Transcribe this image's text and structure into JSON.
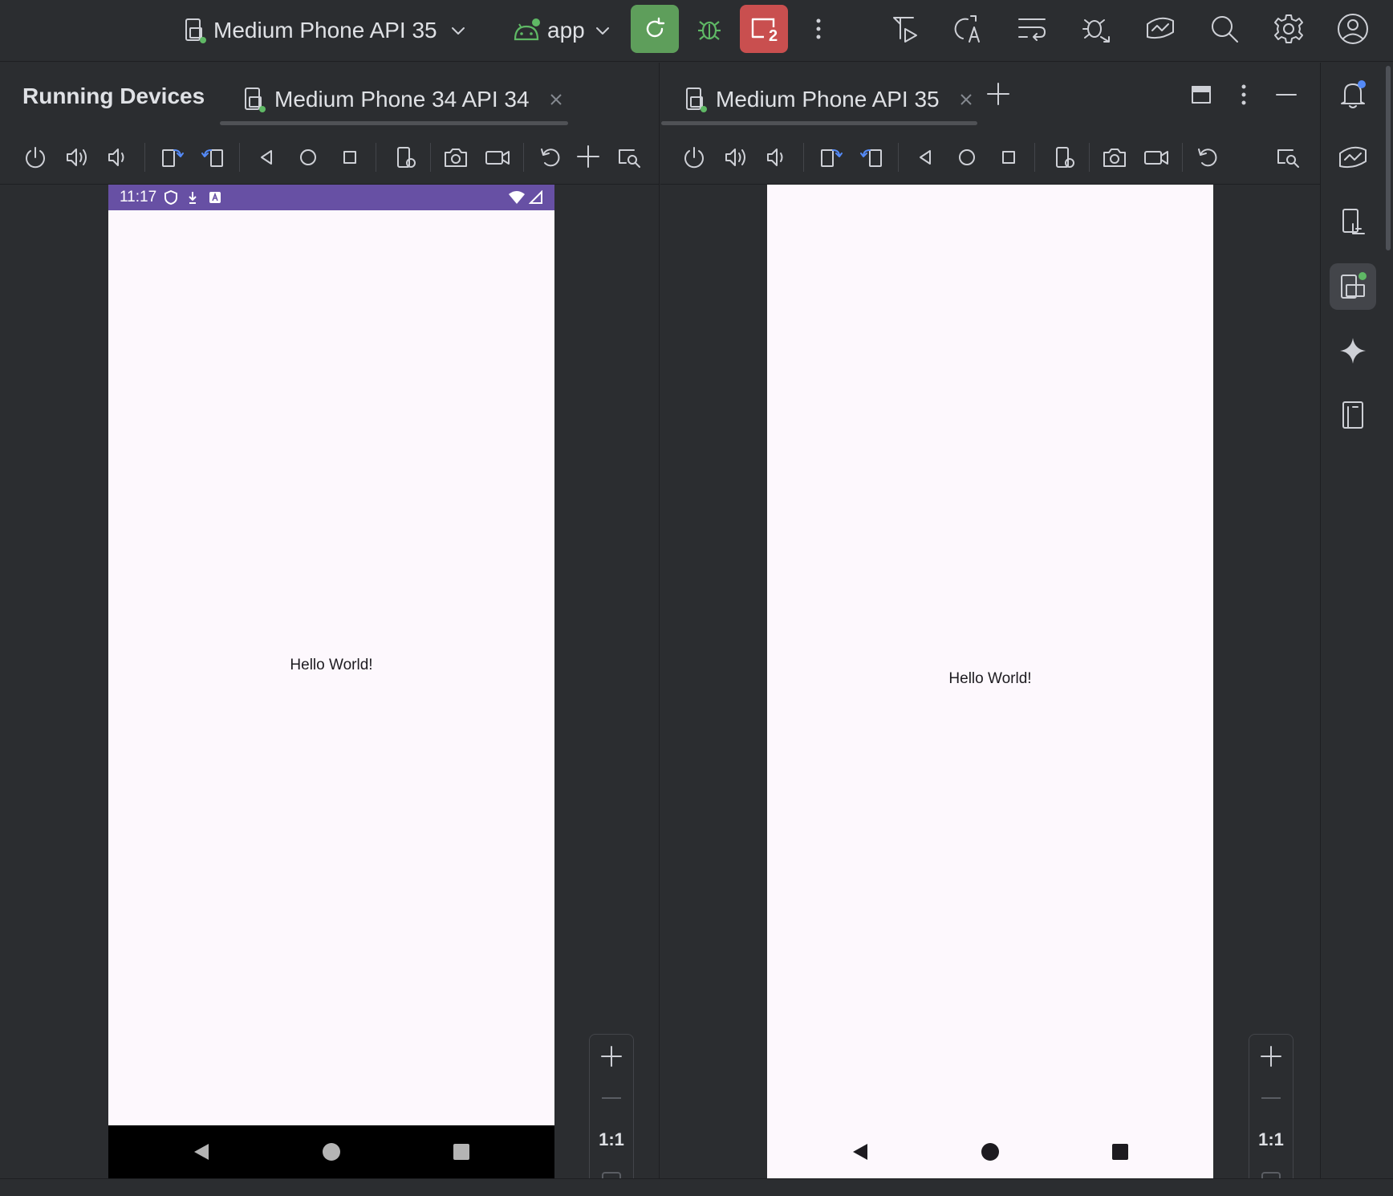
{
  "topbar": {
    "device_selector": "Medium Phone API 35",
    "run_config": "app",
    "device_count_badge": "2"
  },
  "left_panel": {
    "title": "Running Devices",
    "tab_label": "Medium Phone 34 API 34",
    "device": {
      "status_time": "11:17",
      "status_bar_color": "#6750a4",
      "content_text": "Hello World!"
    },
    "zoom": {
      "reset_label": "1:1"
    }
  },
  "right_panel": {
    "tab_label": "Medium Phone API 35",
    "device": {
      "content_text": "Hello World!"
    },
    "zoom": {
      "reset_label": "1:1"
    }
  },
  "colors": {
    "ide_background": "#2b2d30",
    "run_button": "#5e9e5b",
    "stop_button": "#c94f4f",
    "device_screen": "#fdf8fd",
    "accent_blue": "#548af7"
  }
}
